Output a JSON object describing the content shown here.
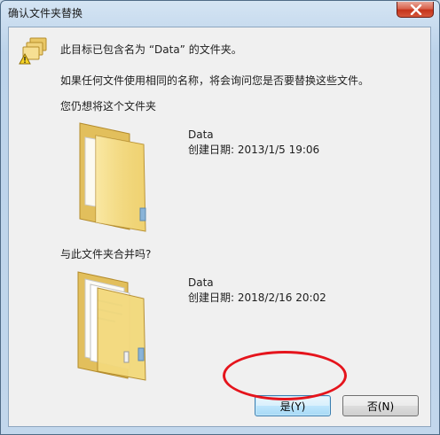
{
  "window": {
    "title": "确认文件夹替换"
  },
  "message": {
    "line1": "此目标已包含名为 “Data” 的文件夹。",
    "line2": "如果任何文件使用相同的名称，将会询问您是否要替换这些文件。",
    "line3": "您仍想将这个文件夹",
    "line4": "与此文件夹合并吗?"
  },
  "target_folder": {
    "name": "Data",
    "created": "创建日期: 2013/1/5 19:06"
  },
  "source_folder": {
    "name": "Data",
    "created": "创建日期: 2018/2/16 20:02"
  },
  "buttons": {
    "yes_label": "是(Y)",
    "no_label": "否(N)"
  },
  "icons": {
    "warning": "warning-folders-icon",
    "folder_empty": "folder-icon",
    "folder_with_files": "folder-with-files-icon",
    "close": "close-icon"
  },
  "colors": {
    "highlight": "#e5141c",
    "close_button": "#c5341b",
    "folder": "#f3d97b"
  }
}
